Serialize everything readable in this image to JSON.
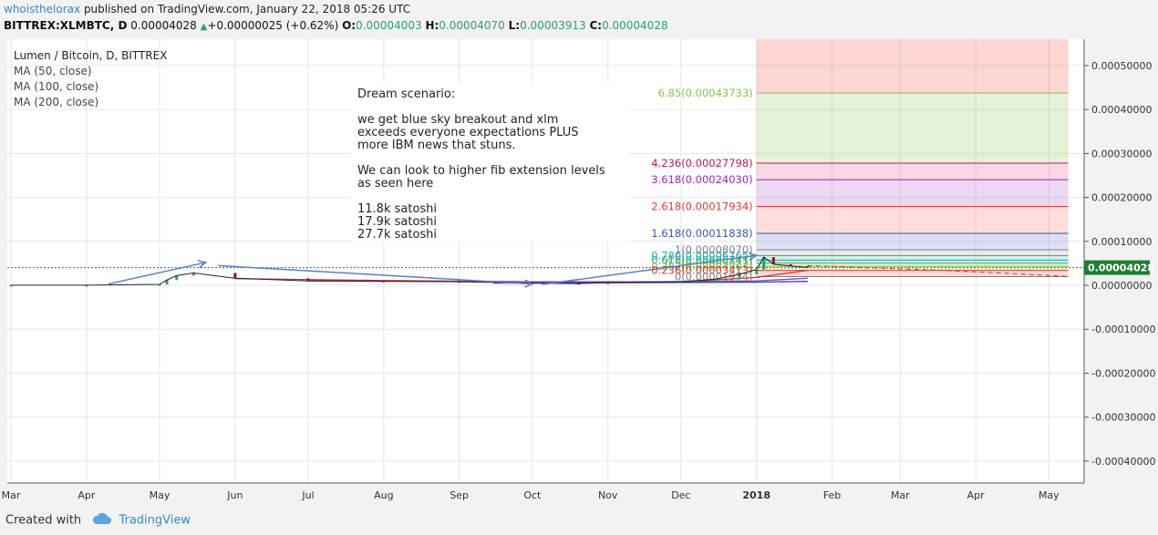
{
  "header": {
    "author": "whoisthelorax",
    "published": "published on TradingView.com, January 22, 2018 05:26 UTC",
    "symbol": "BITTREX:XLMBTC, D",
    "last": "0.00004028",
    "change_arrow": "▲",
    "change": "+0.00000025 (+0.62%)",
    "o_label": "O:",
    "o_value": "0.00004003",
    "h_label": "H:",
    "h_value": "0.00004070",
    "l_label": "L:",
    "l_value": "0.00003913",
    "c_label": "C:",
    "c_value": "0.00004028"
  },
  "legend": {
    "title": "Lumen / Bitcoin, D, BITTREX",
    "items": [
      "MA (50, close)",
      "MA (100, close)",
      "MA (200, close)"
    ]
  },
  "annotation": {
    "lines": [
      "Dream scenario:",
      "",
      "we get blue sky breakout and xlm",
      "exceeds everyone expectations PLUS",
      "more IBM news that stuns.",
      "",
      "We can look to higher fib extension levels",
      "as seen here",
      "",
      "11.8k satoshi",
      "17.9k satoshi",
      "27.7k satoshi"
    ]
  },
  "colors": {
    "up": "#26a269",
    "down": "#8b1a1a",
    "arrow": "#5b7fc4",
    "price_tag": "#1e7e34",
    "grid": "#e6e6e6"
  },
  "chart_data": {
    "type": "candlestick",
    "title": "Lumen / Bitcoin, D, BITTREX",
    "x_ticks": [
      "Mar",
      "Apr",
      "May",
      "Jun",
      "Jul",
      "Aug",
      "Sep",
      "Oct",
      "Nov",
      "Dec",
      "2018",
      "Feb",
      "Mar",
      "Apr",
      "May"
    ],
    "y_ticks": [
      "0.00050000",
      "0.00040000",
      "0.00030000",
      "0.00020000",
      "0.00010000",
      "0.00000000",
      "-0.00010000",
      "-0.00020000",
      "-0.00030000",
      "-0.00040000"
    ],
    "y_tick_values": [
      0.0005,
      0.0004,
      0.0003,
      0.0002,
      0.0001,
      0.0,
      -0.0001,
      -0.0002,
      -0.0003,
      -0.0004
    ],
    "ylim": [
      -0.00045,
      0.00056
    ],
    "last_price": 4.028e-05,
    "last_price_label": "0.00004028",
    "price_series": {
      "x": [
        "2017-03-01",
        "2017-04-01",
        "2017-05-01",
        "2017-05-04",
        "2017-05-08",
        "2017-05-15",
        "2017-06-01",
        "2017-07-01",
        "2017-08-01",
        "2017-09-01",
        "2017-10-01",
        "2017-10-20",
        "2017-11-01",
        "2017-12-01",
        "2017-12-15",
        "2017-12-25",
        "2018-01-01",
        "2018-01-04",
        "2018-01-08",
        "2018-01-15",
        "2018-01-22"
      ],
      "y": [
        3e-07,
        4e-07,
        2e-06,
        1.2e-05,
        2.2e-05,
        2.8e-05,
        1.6e-05,
        1e-05,
        9e-06,
        8e-06,
        5e-06,
        4e-06,
        6e-06,
        8e-06,
        1.4e-05,
        2.5e-05,
        3.6e-05,
        6.4e-05,
        4.8e-05,
        4.4e-05,
        4.028e-05
      ]
    },
    "moving_averages": [
      {
        "name": "MA (50, close)",
        "color": "#c0392b",
        "x": [
          "2017-06-01",
          "2017-08-01",
          "2017-10-01",
          "2017-12-01",
          "2018-01-01",
          "2018-01-22"
        ],
        "y": [
          1.5e-05,
          1.1e-05,
          8e-06,
          8e-06,
          1.8e-05,
          3.4e-05
        ]
      },
      {
        "name": "MA (100, close)",
        "color": "#8e44ad",
        "x": [
          "2017-07-01",
          "2017-09-01",
          "2017-11-01",
          "2018-01-01",
          "2018-01-22"
        ],
        "y": [
          1e-05,
          9e-06,
          7e-06,
          1e-05,
          1.6e-05
        ]
      },
      {
        "name": "MA (200, close)",
        "color": "#2e3fbf",
        "x": [
          "2017-09-15",
          "2017-11-15",
          "2018-01-01",
          "2018-01-22"
        ],
        "y": [
          5e-06,
          6e-06,
          7e-06,
          9e-06
        ]
      }
    ],
    "fib_extension": {
      "levels": [
        {
          "label": "6.85(0.00043733)",
          "value": 0.00043733,
          "color": "#8bc34a"
        },
        {
          "label": "4.236(0.00027798)",
          "value": 0.00027798,
          "color": "#c2185b"
        },
        {
          "label": "3.618(0.00024030)",
          "value": 0.0002403,
          "color": "#9c27b0"
        },
        {
          "label": "2.618(0.00017934)",
          "value": 0.00017934,
          "color": "#e53935"
        },
        {
          "label": "1.618(0.00011838)",
          "value": 0.00011838,
          "color": "#3f51b5"
        },
        {
          "label": "1(0.00008070)",
          "value": 8.07e-05,
          "color": "#808080"
        },
        {
          "label": "0.786(0.00006765)",
          "value": 6.765e-05,
          "color": "#26a69a"
        },
        {
          "label": "0.618(0.00005741)",
          "value": 5.741e-05,
          "color": "#26a69a"
        },
        {
          "label": "0.5(0.00005022)",
          "value": 5.022e-05,
          "color": "#4caf50"
        },
        {
          "label": "0.382(0.00004303)",
          "value": 4.303e-05,
          "color": "#8bc34a"
        },
        {
          "label": "0.236(0.00003413)",
          "value": 3.413e-05,
          "color": "#e53935"
        },
        {
          "label": "0(0.00001974)",
          "value": 1.974e-05,
          "color": "#808080"
        }
      ],
      "x_start": "2018-01-01",
      "x_end": "2018-05-09"
    },
    "forecast_dashed": {
      "x": [
        "2018-01-22",
        "2018-02-15",
        "2018-03-15",
        "2018-04-15",
        "2018-05-09"
      ],
      "y": [
        4.5e-05,
        4e-05,
        3.5e-05,
        2.7e-05,
        2e-05
      ]
    },
    "arrows": [
      {
        "x": [
          "2017-04-10",
          "2017-05-20"
        ],
        "y": [
          3e-06,
          5.2e-05
        ]
      },
      {
        "x": [
          "2017-05-25",
          "2017-10-01"
        ],
        "y": [
          4.5e-05,
          3e-06
        ]
      },
      {
        "x": [
          "2017-10-05",
          "2018-01-01"
        ],
        "y": [
          2e-06,
          6.8e-05
        ]
      }
    ],
    "grid": true
  },
  "footer": {
    "created_with": "Created with",
    "brand": "TradingView"
  }
}
